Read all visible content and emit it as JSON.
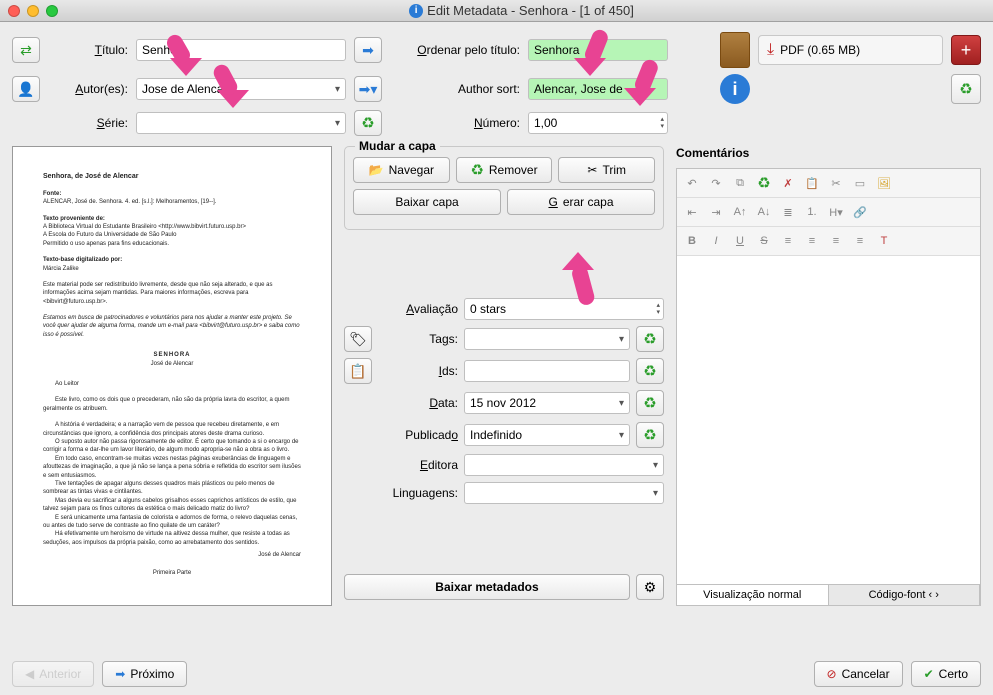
{
  "window": {
    "title": "Edit Metadata - Senhora -  [1 of 450]"
  },
  "labels": {
    "titulo": "Título:",
    "autores": "Autor(es):",
    "serie": "Série:",
    "ordenar_titulo": "Ordenar pelo título:",
    "author_sort": "Author sort:",
    "numero": "Número:"
  },
  "fields": {
    "titulo": "Senhora",
    "autores": "Jose de Alencar",
    "serie": "",
    "ordenar_titulo": "Senhora",
    "author_sort": "Alencar, Jose de",
    "numero": "1,00"
  },
  "cover_group": {
    "title": "Mudar a capa",
    "navegar": "Navegar",
    "remover": "Remover",
    "trim": "Trim",
    "baixar_capa": "Baixar capa",
    "gerar_capa": "Gerar capa"
  },
  "meta_fields": {
    "avaliacao_label": "Avaliação",
    "avaliacao_value": "0 stars",
    "tags_label": "Tags:",
    "tags_value": "",
    "ids_label": "Ids:",
    "ids_value": "",
    "data_label": "Data:",
    "data_value": "15 nov 2012",
    "publicado_label": "Publicado",
    "publicado_value": "Indefinido",
    "editora_label": "Editora",
    "editora_value": "",
    "linguagens_label": "Linguagens:",
    "linguagens_value": "",
    "baixar_metadados": "Baixar metadados"
  },
  "formats": {
    "pdf_label": "PDF (0.65 MB)"
  },
  "comments": {
    "title": "Comentários",
    "tab_normal": "Visualização normal",
    "tab_code": "Código-font"
  },
  "footer": {
    "anterior": "Anterior",
    "proximo": "Próximo",
    "cancelar": "Cancelar",
    "certo": "Certo"
  },
  "cover_text": {
    "title": "Senhora, de José de Alencar",
    "fonte_h": "Fonte:",
    "fonte": "ALENCAR, José de. Senhora. 4. ed. [s.l.]: Melhoramentos, [19--].",
    "prov_h": "Texto proveniente de:",
    "prov1": "A Biblioteca Virtual do Estudante Brasileiro <http://www.bibvirt.futuro.usp.br>",
    "prov2": "A Escola do Futuro da Universidade de São Paulo",
    "prov3": "Permitido o uso apenas para fins educacionais.",
    "dig_h": "Texto-base digitalizado por:",
    "dig": "Márcia Zalike",
    "p1": "Este material pode ser redistribuído livremente, desde que não seja alterado, e que as informações acima sejam mantidas. Para maiores informações, escreva para <bibvirt@futuro.usp.br>.",
    "p2": "Estamos em busca de patrocinadores e voluntários para nos ajudar a manter este projeto. Se você quer ajudar de alguma forma, mande um e-mail para <bibvirt@futuro.usp.br> e saiba como isso é possível.",
    "center1": "SENHORA",
    "center2": "José de Alencar",
    "leitor_h": "Ao Leitor",
    "lp1": "Este livro, como os dois que o precederam, não são da própria lavra do escritor, a quem geralmente os atribuem.",
    "lp2": "A história é verdadeira; e a narração vem de pessoa que recebeu diretamente, e em circunstâncias que ignoro, a confidência dos principais atores deste drama curioso.",
    "lp3": "O suposto autor não passa rigorosamente de editor. É certo que tomando a si o encargo de corrigir a forma e dar-lhe um lavor literário, de algum modo apropria-se não a obra as o livro.",
    "lp4": "Em todo caso, encontram-se muitas vezes nestas páginas exuberâncias de linguagem e afouttezas de imaginação, a que já não se lança a pena sóbria e refletida do escritor sem ilusões e sem entusiasmos.",
    "lp5": "Tive tentações de apagar alguns desses quadros mais plásticos ou pelo menos de sombrear as tintas vivas e cintilantes.",
    "lp6": "Mas devia eu sacrificar a alguns cabelos grisalhos esses caprichos artísticos de estilo, que talvez sejam para os finos cultores da estética o mais delicado matiz do livro?",
    "lp7": "E será unicamente uma fantasia de colorista e adornos de forma, o relevo daquelas cenas, ou antes de tudo serve de contraste ao fino quilate de um caráter?",
    "lp8": "Há efetivamente um heroísmo de virtude na altivez dessa mulher, que resiste a todas as seduções, aos impulsos da própria paixão, como ao arrebatamento dos sentidos.",
    "sig": "José de Alencar",
    "parte": "Primeira Parte"
  }
}
